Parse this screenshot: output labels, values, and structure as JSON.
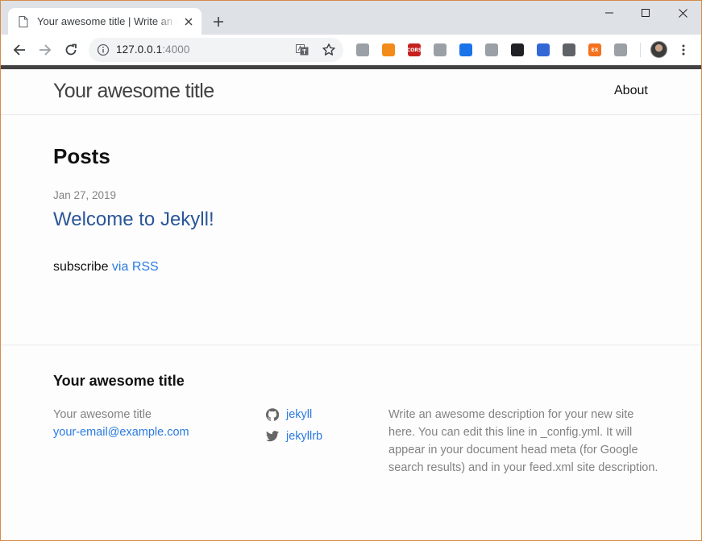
{
  "browser": {
    "tab_title": "Your awesome title | Write an awesome description for your new site here.",
    "url_host": "127.0.0.1",
    "url_port": ":4000",
    "extensions": [
      {
        "name": "globe-extension-icon",
        "color": "#9aa0a6",
        "label": ""
      },
      {
        "name": "chart-extension-icon",
        "color": "#f28b1a",
        "label": ""
      },
      {
        "name": "cors-extension-icon",
        "color": "#c5221f",
        "label": "CORS"
      },
      {
        "name": "layout-extension-icon",
        "color": "#9aa0a6",
        "label": ""
      },
      {
        "name": "translate-extension-icon",
        "color": "#1a73e8",
        "label": ""
      },
      {
        "name": "window-extension-icon",
        "color": "#9aa0a6",
        "label": ""
      },
      {
        "name": "mask-extension-icon",
        "color": "#202124",
        "label": ""
      },
      {
        "name": "earth-extension-icon",
        "color": "#3367d6",
        "label": ""
      },
      {
        "name": "vue-extension-icon",
        "color": "#5f6368",
        "label": ""
      },
      {
        "name": "ex-extension-icon",
        "color": "#f4711e",
        "label": "EX"
      },
      {
        "name": "link-extension-icon",
        "color": "#9aa0a6",
        "label": ""
      }
    ]
  },
  "header": {
    "site_title": "Your awesome title",
    "nav_about": "About"
  },
  "main": {
    "heading": "Posts",
    "posts": [
      {
        "date": "Jan 27, 2019",
        "title": "Welcome to Jekyll!"
      }
    ],
    "subscribe_text": "subscribe ",
    "rss_link": "via RSS"
  },
  "footer": {
    "heading": "Your awesome title",
    "name": "Your awesome title",
    "email": "your-email@example.com",
    "github": "jekyll",
    "twitter": "jekyllrb",
    "description": "Write an awesome description for your new site here. You can edit this line in _config.yml. It will appear in your document head meta (for Google search results) and in your feed.xml site description."
  },
  "colors": {
    "link": "#2a7ae2",
    "post_title": "#2a5599",
    "muted": "#828282",
    "top_bar": "#424242"
  }
}
